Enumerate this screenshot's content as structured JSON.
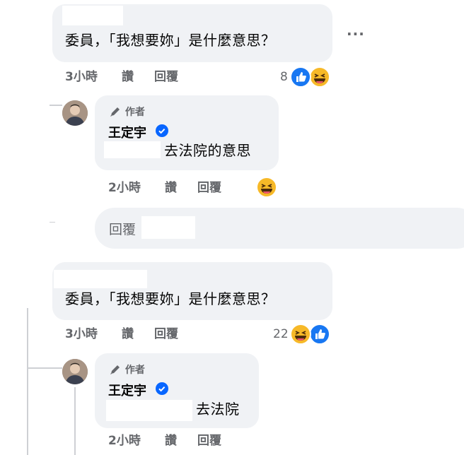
{
  "comments": [
    {
      "text": "委員，「我想要妳」是什麼意思？",
      "time": "3小時",
      "action_like": "讚",
      "action_reply": "回覆",
      "reaction_count": "8",
      "reactions": [
        "like-icon",
        "haha-icon"
      ],
      "more_label": "···",
      "reply": {
        "badge": "作者",
        "author": "王定宇",
        "text": "去法院的意思",
        "time": "2小時",
        "action_like": "讚",
        "action_reply": "回覆",
        "reactions": [
          "haha-icon"
        ]
      }
    },
    {
      "text": "委員，「我想要妳」是什麼意思？",
      "time": "3小時",
      "action_like": "讚",
      "action_reply": "回覆",
      "reaction_count": "22",
      "reactions": [
        "haha-icon",
        "like-icon"
      ],
      "reply": {
        "badge": "作者",
        "author": "王定宇",
        "text": "去法院",
        "time": "2小時",
        "action_like": "讚",
        "action_reply": "回覆"
      }
    }
  ],
  "reply_input": {
    "placeholder": "回覆"
  },
  "colors": {
    "like": "#1877f2",
    "haha": "#f7b928",
    "bubble": "#f0f2f5",
    "meta": "#65676b",
    "verified": "#0866ff"
  }
}
